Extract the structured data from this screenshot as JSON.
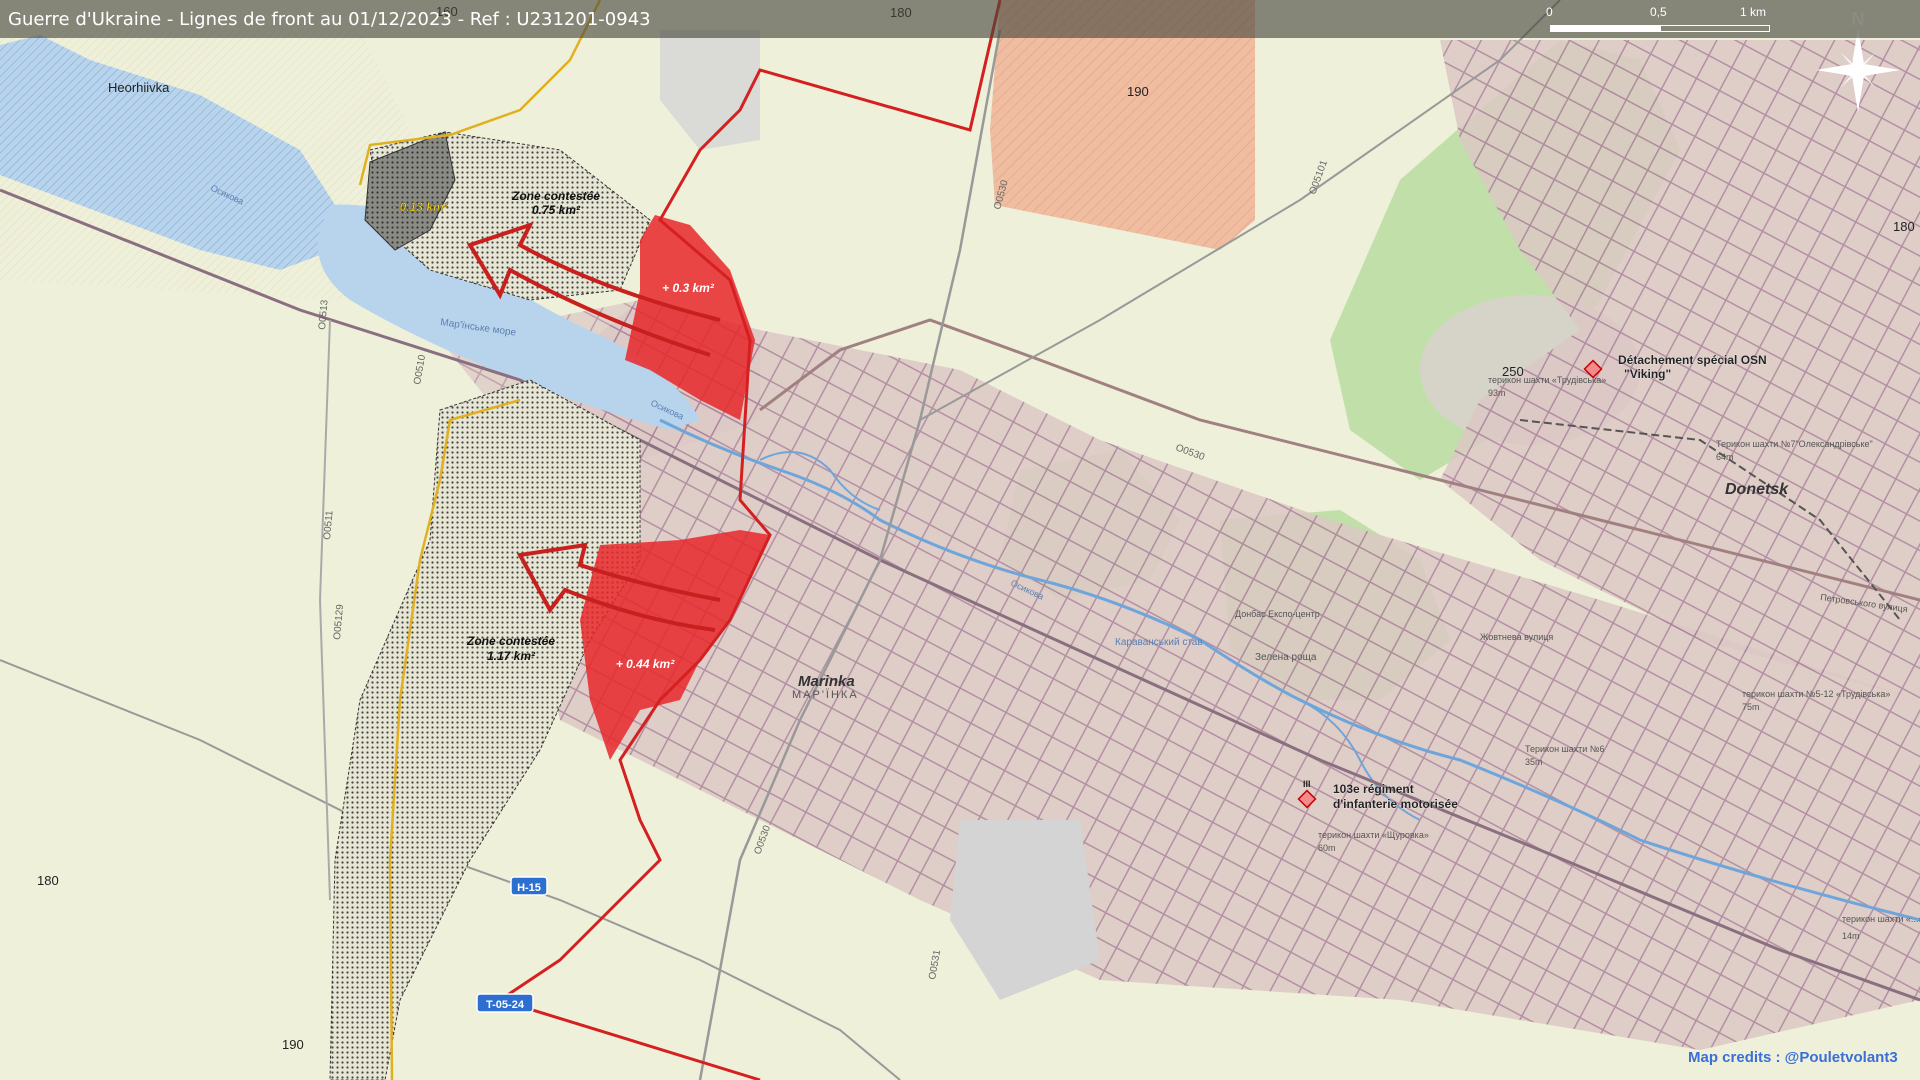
{
  "title": "Guerre d'Ukraine - Lignes de front au 01/12/2023 - Ref : U231201-0943",
  "scale": {
    "label_0": "0",
    "label_mid": "0,5",
    "label_end": "1 km"
  },
  "north_label": "N",
  "places": {
    "heorhiivka": "Heorhiivka",
    "marinka": "Marinka",
    "marinka_cyr": "МАР'ЇНКА",
    "donetsk": "Donetsk",
    "reservoir": "Мар'їнське море",
    "osykova_1": "Осикова",
    "osykova_2": "Осикова",
    "osykova_3": "Осикова",
    "karavan": "Караванський став",
    "zelena": "Зелена роща",
    "donbas": "Донбас Експо-центр",
    "petr": "Петровського вулиця",
    "zhovtneva": "Жовтнева вулиця"
  },
  "terrikons": [
    {
      "name": "терикон шахти «Трудівська»",
      "height": "93m"
    },
    {
      "name": "Терикон шахти №7\"Олександрівське\"",
      "height": "64m"
    },
    {
      "name": "терикон шахти №5-12 «Трудівська»",
      "height": "75m"
    },
    {
      "name": "Терикон шахти №6",
      "height": "35m"
    },
    {
      "name": "терикон шахти «Щуровка»",
      "height": "60m"
    },
    {
      "name": "терикон шахти «...»",
      "height": "14m"
    }
  ],
  "elevations": {
    "e160": "160",
    "e180_top": "180",
    "e190_top": "190",
    "e180_right": "180",
    "e250": "250",
    "e180_left": "180",
    "e190_bottom": "190"
  },
  "roads": {
    "h15": "H-15",
    "t0524": "T-05-24",
    "o0530a": "O0530",
    "o0530b": "O0530",
    "o0530c": "O0530",
    "o0510": "O0510",
    "o0511": "O0511",
    "o05129": "O05129",
    "o0513": "O0513",
    "o05101": "O05101",
    "o0531": "O0531"
  },
  "zones": {
    "contested_1_title": "Zone contestée",
    "contested_1_area": "0.75 km²",
    "contested_2_title": "Zone contestée",
    "contested_2_area": "1.17 km²",
    "loss_label": "- 0.13 km²",
    "gain_1_label": "+ 0.3 km²",
    "gain_2_label": "+ 0.44 km²"
  },
  "units": {
    "unit_1_line1": "Détachement spécial OSN",
    "unit_1_line2": "\"Viking\"",
    "unit_2_line1": "103e régiment",
    "unit_2_line2": "d'infanterie motorisée",
    "unit_2_symbol": "III"
  },
  "credits": "Map credits : @Pouletvolant3",
  "colors": {
    "front_line": "#d42020",
    "gain_fill": "#e8272a",
    "contested_line": "#e0b020",
    "urban": "#d9c4c2",
    "water": "#b8d4ec",
    "forest": "#b9dca0",
    "farmland": "#eef0d9",
    "occupied_zone": "#f0b79a"
  }
}
